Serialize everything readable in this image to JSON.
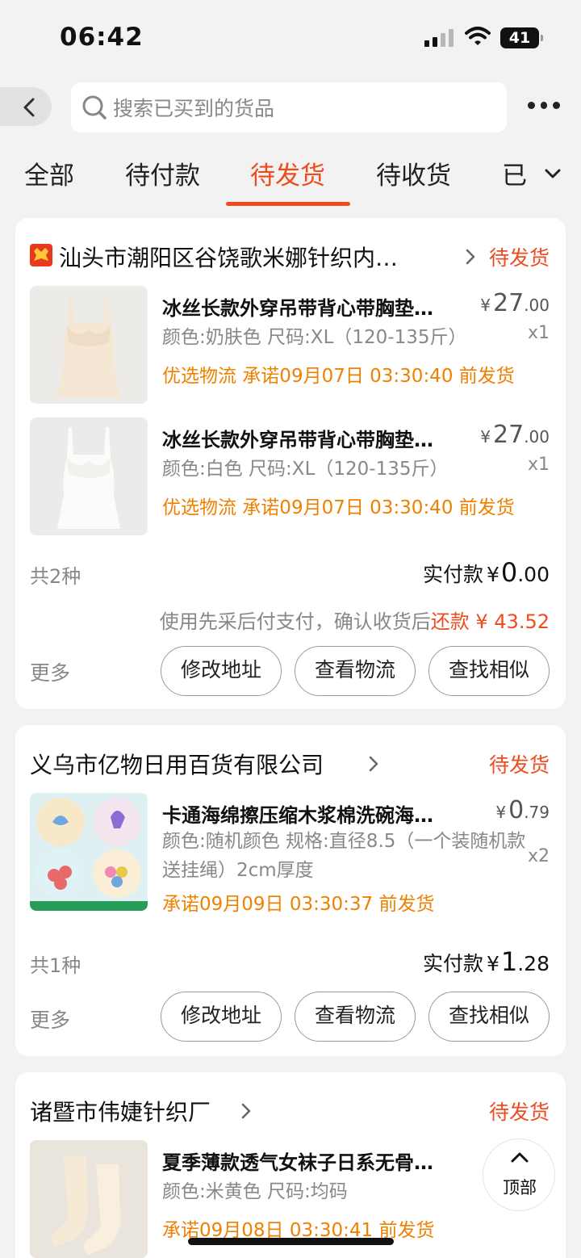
{
  "status_bar": {
    "time": "06:42",
    "battery": "41"
  },
  "search": {
    "placeholder": "搜索已买到的货品"
  },
  "tabs": [
    {
      "label": "全部"
    },
    {
      "label": "待付款"
    },
    {
      "label": "待发货",
      "active": true
    },
    {
      "label": "待收货"
    },
    {
      "label": "已"
    }
  ],
  "orders": [
    {
      "shop": "汕头市潮阳区谷饶歌米娜针织内…",
      "status": "待发货",
      "items": [
        {
          "title": "冰丝长款外穿吊带背心带胸垫…",
          "spec": "颜色:奶肤色 尺码:XL（120-135斤）",
          "promise": "优选物流 承诺09月07日 03:30:40 前发货",
          "price_int": "27",
          "price_dec": ".00",
          "qty": "x1"
        },
        {
          "title": "冰丝长款外穿吊带背心带胸垫…",
          "spec": "颜色:白色 尺码:XL（120-135斤）",
          "promise": "优选物流 承诺09月07日 03:30:40 前发货",
          "price_int": "27",
          "price_dec": ".00",
          "qty": "x1"
        }
      ],
      "count": "共2种",
      "paid_label": "实付款",
      "paid_int": "0",
      "paid_dec": ".00",
      "note_prefix": "使用先采后付支付，确认收货后",
      "note_highlight": "还款 ¥ 43.52",
      "more": "更多",
      "buttons": [
        "修改地址",
        "查看物流",
        "查找相似"
      ]
    },
    {
      "shop": "义乌市亿物日用百货有限公司",
      "status": "待发货",
      "items": [
        {
          "title": "卡通海绵擦压缩木浆棉洗碗海…",
          "spec": "颜色:随机颜色 规格:直径8.5（一个装随机款送挂绳）2cm厚度",
          "promise": "承诺09月09日 03:30:37 前发货",
          "price_int": "0",
          "price_dec": ".79",
          "qty": "x2"
        }
      ],
      "count": "共1种",
      "paid_label": "实付款",
      "paid_int": "1",
      "paid_dec": ".28",
      "more": "更多",
      "buttons": [
        "修改地址",
        "查看物流",
        "查找相似"
      ]
    },
    {
      "shop": "诸暨市伟婕针织厂",
      "status": "待发货",
      "items": [
        {
          "title": "夏季薄款透气女袜子日系无骨…",
          "spec": "颜色:米黄色 尺码:均码",
          "promise": "承诺09月08日 03:30:41 前发货"
        }
      ]
    }
  ],
  "top_button": {
    "label": "顶部"
  },
  "colors": {
    "accent": "#ee4b1e",
    "promise": "#f08000",
    "muted": "#888888"
  }
}
